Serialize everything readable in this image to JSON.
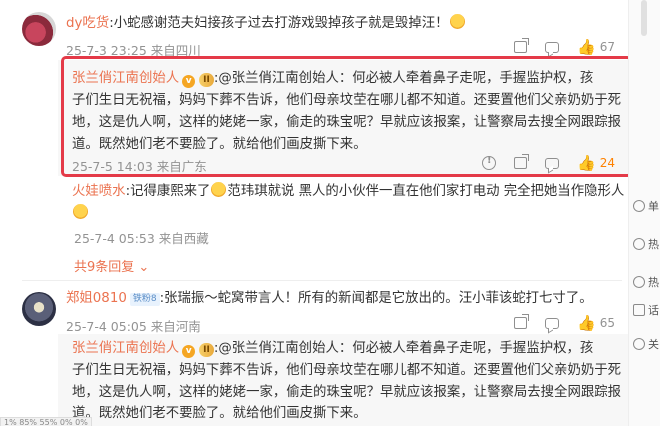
{
  "comment1": {
    "user": "dy吃货",
    "text": ":小蛇感谢范夫妇接孩子过去打游戏毁掉孩子就是毁掉汪！",
    "meta": "25-7-3 23:25 来自四川",
    "like_count": "67"
  },
  "reply1": {
    "user": "张兰俏江南创始人",
    "vip_badge": "v",
    "level_badge": "II",
    "lines": [
      ":@张兰俏江南创始人：何必被人牵着鼻子走呢，手握监护权，孩",
      "子们生日无祝福，妈妈下葬不告诉，他们母亲坟茔在哪儿都不知道。还要置他们父亲奶奶于死",
      "地，这是仇人啊，这样的姥姥一家，偷走的珠宝呢？早就应该报案，让警察局去搜全网跟踪报",
      "道。既然她们老不要脸了。就给他们画皮撕下来。"
    ],
    "meta": "25-7-5 14:03 来自广东",
    "like_count": "24"
  },
  "reply2": {
    "user": "火娃喷水",
    "line1": ":记得康熙来了",
    "line1b": "范玮琪就说  黑人的小伙伴一直在他们家打电动  完全把她当作隐形人",
    "meta": "25-7-4 05:53 来自西藏"
  },
  "more_replies": "共9条回复",
  "comment2": {
    "user": "郑姐0810",
    "fan_badge": "铁粉8",
    "text": ":张瑞振～蛇窝带言人！所有的新闻都是它放出的。汪小菲该蛇打七寸了。",
    "meta": "25-7-4 05:05 来自河南",
    "like_count": "65"
  },
  "reply3": {
    "user": "张兰俏江南创始人",
    "lines": [
      ":@张兰俏江南创始人：何必被人牵着鼻子走呢，手握监护权，孩",
      "子们生日无祝福，妈妈下葬不告诉，他们母亲坟茔在哪儿都不知道。还要置他们父亲奶奶于死",
      "地，这是仇人啊，这样的姥姥一家，偷走的珠宝呢？早就应该报案，让警察局去搜全网跟踪报",
      "道。既然她们老不要脸了。就给他们画皮撕下来。"
    ]
  },
  "status_url": "1% 85% 55% 0% 0%",
  "sidebar": {
    "items": [
      "单",
      "热",
      "热",
      "话",
      "关"
    ]
  },
  "colors": {
    "name": "#eb7350",
    "highlight": "#e43a48",
    "like": "#ff8200"
  }
}
